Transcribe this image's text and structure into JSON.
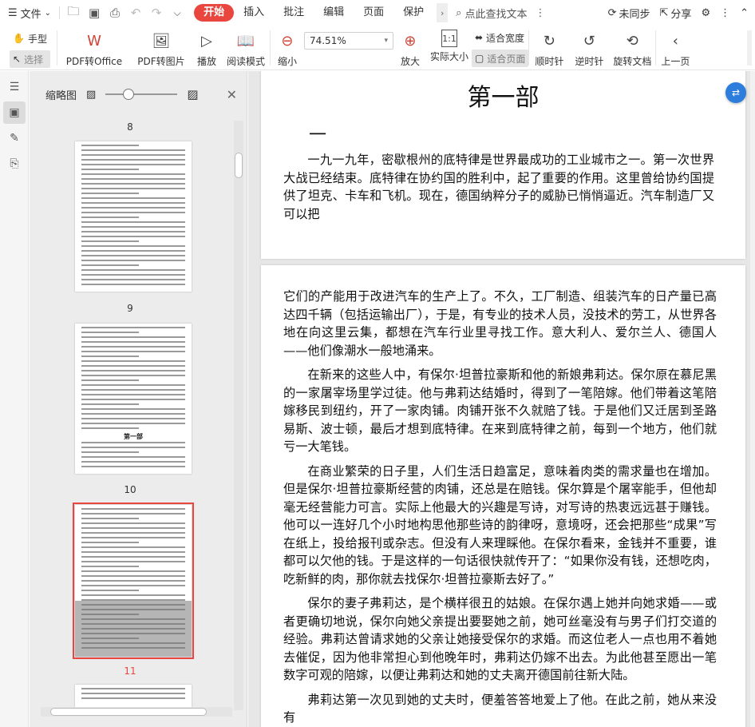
{
  "menu": {
    "file": "文件",
    "tabs": [
      "开始",
      "插入",
      "批注",
      "编辑",
      "页面",
      "保护"
    ],
    "active_tab": "开始",
    "search": "点此查找文本",
    "sync": "未同步",
    "share": "分享"
  },
  "ribbon": {
    "hand": "手型",
    "select": "选择",
    "pdf_to_office": "PDF转Office",
    "pdf_to_image": "PDF转图片",
    "play": "播放",
    "read_mode": "阅读模式",
    "zoom_out": "缩小",
    "zoom_value": "74.51%",
    "zoom_in": "放大",
    "actual_size": "实际大小",
    "fit_width": "适合宽度",
    "fit_page": "适合页面",
    "rotate_cw": "顺时针",
    "rotate_ccw": "逆时针",
    "rotate_doc": "旋转文档",
    "prev_page": "上一页"
  },
  "thumbnails": {
    "title": "缩略图",
    "pages": [
      "8",
      "9",
      "10",
      "11"
    ],
    "current_page": "11",
    "thumb9_heading": "第一部"
  },
  "document": {
    "page1": {
      "title": "第一部",
      "dash": "一",
      "para": "一九一九年，密歇根州的底特律是世界最成功的工业城市之一。第一次世界大战已经结束。底特律在协约国的胜利中，起了重要的作用。这里曾给协约国提供了坦克、卡车和飞机。现在，德国纳粹分子的威胁已悄悄逼近。汽车制造厂又可以把"
    },
    "page2": {
      "paras": [
        "它们的产能用于改进汽车的生产上了。不久，工厂制造、组装汽车的日产量已高达四千辆（包括运输出厂），于是，有专业的技术人员，没技术的劳工，从世界各地在向这里云集，都想在汽车行业里寻找工作。意大利人、爱尔兰人、德国人——他们像潮水一般地涌来。",
        "在新来的这些人中，有保尔·坦普拉豪斯和他的新娘弗莉达。保尔原在慕尼黑的一家屠宰场里学过徒。他与弗莉达结婚时，得到了一笔陪嫁。他们带着这笔陪嫁移民到纽约，开了一家肉铺。肉铺开张不久就赔了钱。于是他们又迁居到圣路易斯、波士顿，最后才想到底特律。在来到底特律之前，每到一个地方，他们就亏一大笔钱。",
        "在商业繁荣的日子里，人们生活日趋富足，意味着肉类的需求量也在增加。但是保尔·坦普拉豪斯经营的肉铺，还总是在赔钱。保尔算是个屠宰能手，但他却毫无经营能力可言。实际上他最大的兴趣是写诗，对写诗的热衷远远甚于赚钱。他可以一连好几个小时地构思他那些诗的韵律呀，意境呀，还会把那些“成果”写在纸上，投给报刊或杂志。但没有人来理睬他。在保尔看来，金钱并不重要，谁都可以欠他的钱。于是这样的一句话很快就传开了：“如果你没有钱，还想吃肉，吃新鲜的肉，那你就去找保尔·坦普拉豪斯去好了。”",
        "保尔的妻子弗莉达，是个横样很丑的姑娘。在保尔遇上她并向她求婚——或者更确切地说，保尔向她父亲提出要娶她之前，她可丝毫没有与男子们打交道的经验。弗莉达曾请求她的父亲让她接受保尔的求婚。而这位老人一点也用不着她去催促，因为他非常担心到他晚年时，弗莉达仍嫁不出去。为此他甚至愿出一笔数字可观的陪嫁，以便让弗莉达和她的丈夫离开德国前往新大陆。",
        "弗莉达第一次见到她的丈夫时，便羞答答地爱上了他。在此之前，她从来没有"
      ]
    }
  }
}
